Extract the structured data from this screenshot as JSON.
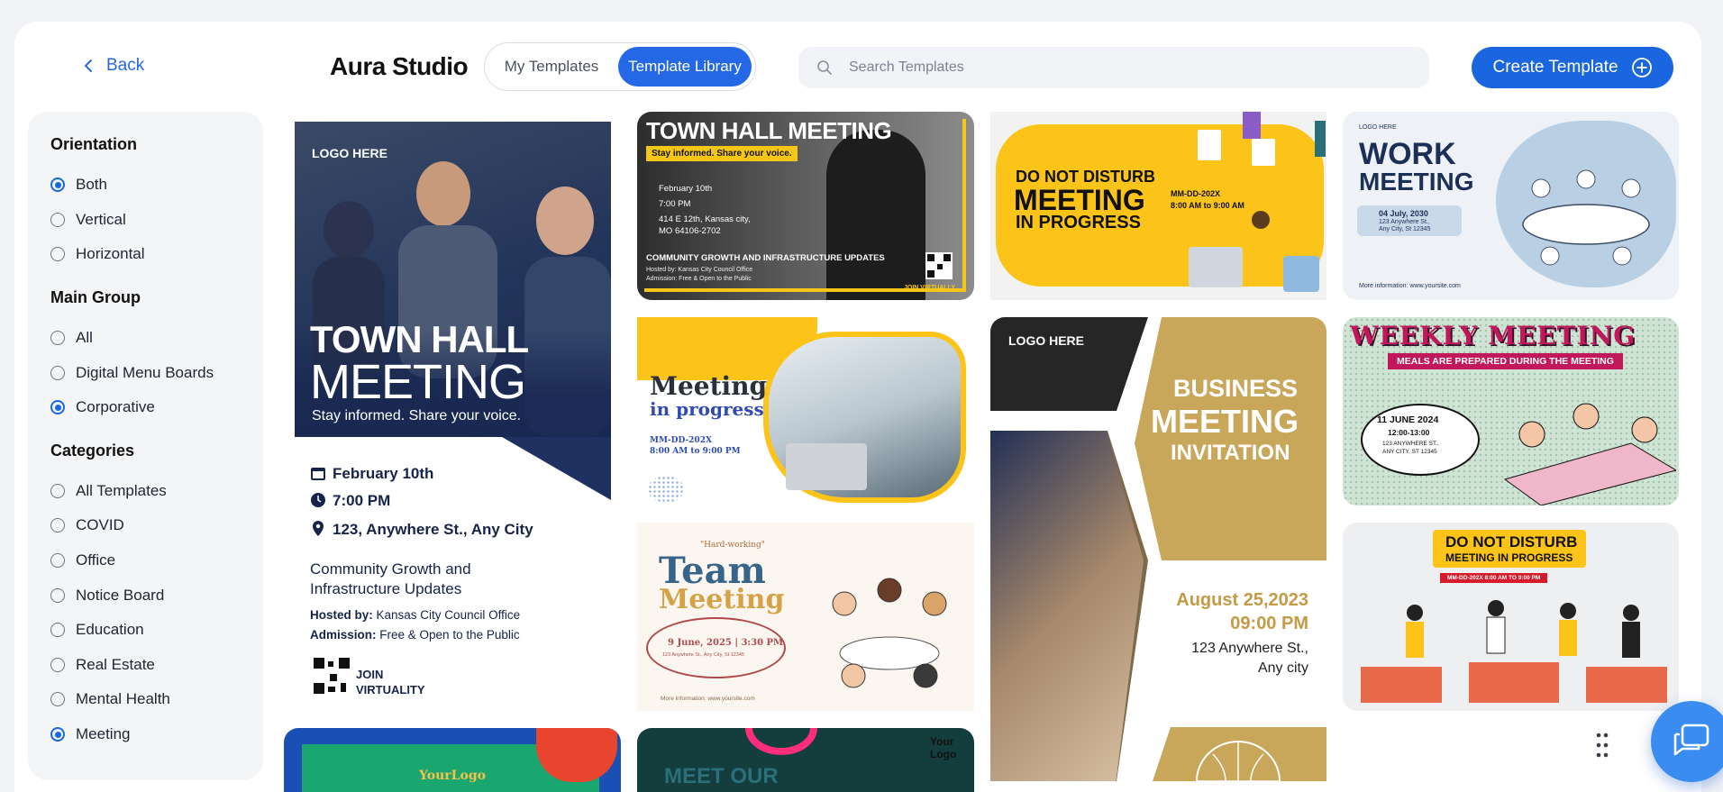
{
  "header": {
    "back_label": "Back",
    "brand": "Aura Studio",
    "tabs": [
      {
        "label": "My Templates",
        "active": false
      },
      {
        "label": "Template Library",
        "active": true
      }
    ],
    "search_placeholder": "Search Templates",
    "create_label": "Create Template"
  },
  "sidebar": {
    "orientation": {
      "title": "Orientation",
      "options": [
        {
          "label": "Both",
          "checked": true
        },
        {
          "label": "Vertical",
          "checked": false
        },
        {
          "label": "Horizontal",
          "checked": false
        }
      ]
    },
    "main_group": {
      "title": "Main Group",
      "options": [
        {
          "label": "All",
          "checked": false
        },
        {
          "label": "Digital Menu Boards",
          "checked": false
        },
        {
          "label": "Corporative",
          "checked": true
        }
      ]
    },
    "categories": {
      "title": "Categories",
      "options": [
        {
          "label": "All Templates",
          "checked": false
        },
        {
          "label": "COVID",
          "checked": false
        },
        {
          "label": "Office",
          "checked": false
        },
        {
          "label": "Notice Board",
          "checked": false
        },
        {
          "label": "Education",
          "checked": false
        },
        {
          "label": "Real Estate",
          "checked": false
        },
        {
          "label": "Mental Health",
          "checked": false
        },
        {
          "label": "Meeting",
          "checked": true
        }
      ]
    }
  },
  "templates": {
    "town_hall_v": {
      "logo": "LOGO HERE",
      "title1": "TOWN HALL",
      "title2": "MEETING",
      "tagline": "Stay informed. Share your voice.",
      "date": "February 10th",
      "time": "7:00 PM",
      "address": "123, Anywhere St., Any City",
      "topic1": "Community Growth and",
      "topic2": "Infrastructure Updates",
      "hosted_label": "Hosted by:",
      "hosted_value": "Kansas City Council Office",
      "admission_label": "Admission:",
      "admission_value": "Free & Open to the Public",
      "join1": "JOIN",
      "join2": "VIRTUALITY"
    },
    "town_hall_h": {
      "title": "TOWN HALL MEETING",
      "tagline": "Stay informed. Share your voice.",
      "date": "February 10th",
      "time": "7:00 PM",
      "address1": "414 E 12th, Kansas city,",
      "address2": "MO 64106-2702",
      "topic": "COMMUNITY GROWTH AND INFRASTRUCTURE UPDATES",
      "hosted": "Hosted by: Kansas City Council Office",
      "admission": "Admission: Free & Open to the Public",
      "join": "JOIN VIRTUALLY"
    },
    "dnd_yellow": {
      "line1": "DO NOT DISTURB",
      "line2": "MEETING",
      "line3": "IN PROGRESS",
      "code": "MM-DD-202X",
      "hours": "8:00 AM to 9:00 AM"
    },
    "work_meeting": {
      "logo": "LOGO HERE",
      "title1": "WORK",
      "title2": "MEETING",
      "date": "04 July, 2030",
      "addr1": "123 Anywhere St.,",
      "addr2": "Any City, St 12345",
      "info": "More information: www.yoursite.com"
    },
    "meeting_progress": {
      "title1": "Meeting",
      "title2": "in progress",
      "code": "MM-DD-202X",
      "hours": "8:00 AM to 9:00 PM"
    },
    "business_meeting": {
      "logo": "LOGO HERE",
      "title1": "BUSINESS",
      "title2": "MEETING",
      "title3": "INVITATION",
      "date": "August 25,2023",
      "time": "09:00 PM",
      "addr1": "123 Anywhere St.,",
      "addr2": "Any city"
    },
    "weekly_meeting": {
      "title": "WEEKLY MEETING",
      "subtitle": "MEALS ARE PREPARED DURING THE MEETING",
      "date": "11 JUNE 2024",
      "time": "12:00-13:00",
      "addr1": "123 ANYWHERE ST.,",
      "addr2": "ANY CITY, ST 12345"
    },
    "team_meeting": {
      "kicker": "\"Hard-working\"",
      "title1": "Team",
      "title2": "Meeting",
      "when": "9 June, 2025 | 3:30 PM",
      "addr": "123 Anywhere St., Any City, St 12345",
      "info": "More information: www.yoursite.com"
    },
    "dnd_red": {
      "line1": "DO NOT DISTURB",
      "line2": "MEETING IN PROGRESS",
      "code": "MM-DD-202X  8:00 AM TO 9:00 PM"
    },
    "partial_1": {
      "logo": "YourLogo"
    },
    "partial_2": {
      "title": "MEET OUR",
      "logo1": "Your",
      "logo2": "Logo"
    }
  },
  "colors": {
    "accent": "#1966e0",
    "navy": "#16244a",
    "gold": "#c9a95c",
    "yellow": "#fcc419"
  }
}
